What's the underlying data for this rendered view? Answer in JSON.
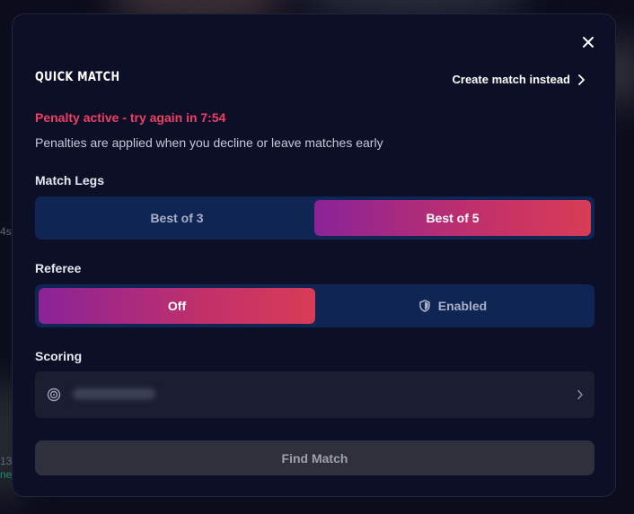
{
  "background": {
    "text_1": "4s",
    "text_2": "13",
    "text_3": "ne"
  },
  "modal": {
    "title": "QUICK MATCH",
    "create_link": "Create match instead",
    "penalty": "Penalty active - try again in 7:54",
    "penalty_note": "Penalties are applied when you decline or leave matches early",
    "match_legs": {
      "label": "Match Legs",
      "options": [
        "Best of 3",
        "Best of 5"
      ],
      "selected": "Best of 5"
    },
    "referee": {
      "label": "Referee",
      "options": [
        "Off",
        "Enabled"
      ],
      "selected": "Off"
    },
    "scoring": {
      "label": "Scoring",
      "value_blurred": true
    },
    "find_button": "Find Match"
  },
  "icons": {
    "close": "close-icon",
    "create_chevron": "chevron-right-icon",
    "referee": "shield-icon",
    "scoring": "target-icon",
    "scoring_chevron": "chevron-right-icon"
  },
  "colors": {
    "modal_bg": "#0c0f25",
    "segment_bg": "#0f2553",
    "gradient_start": "#8a2398",
    "gradient_end": "#d83c55",
    "penalty": "#ef3f66",
    "button_bg": "#2e303b"
  }
}
